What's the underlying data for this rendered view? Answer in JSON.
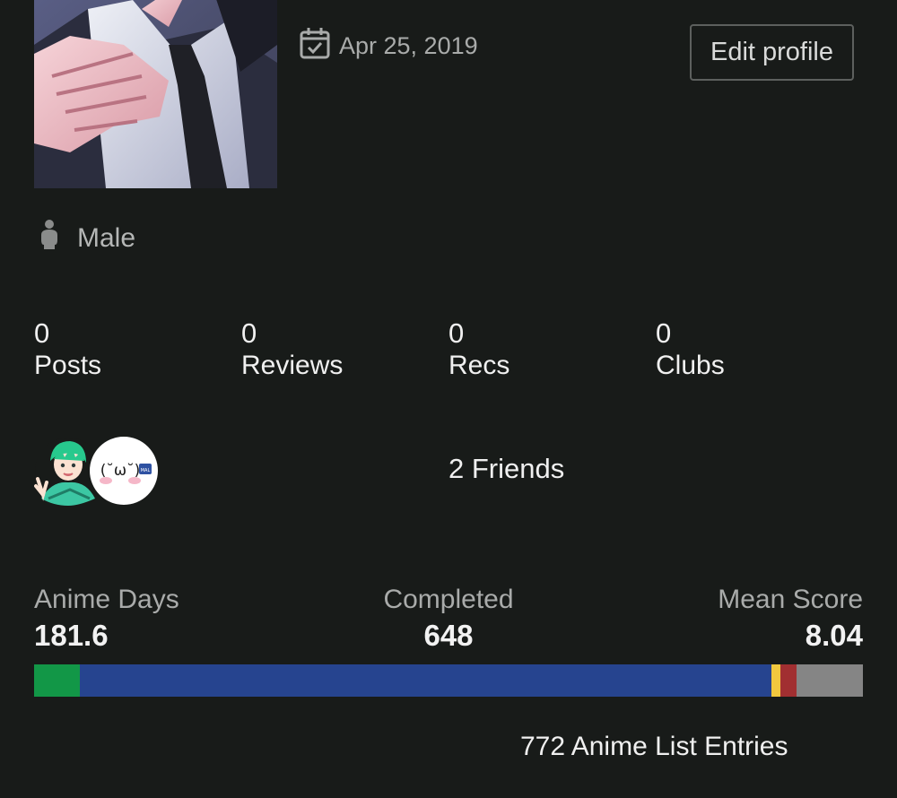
{
  "profile": {
    "joined_date": "Apr 25, 2019",
    "edit_label": "Edit profile",
    "gender": "Male"
  },
  "stats": [
    {
      "count": "0",
      "label": "Posts"
    },
    {
      "count": "0",
      "label": "Reviews"
    },
    {
      "count": "0",
      "label": "Recs"
    },
    {
      "count": "0",
      "label": "Clubs"
    }
  ],
  "friends": {
    "label": "2 Friends",
    "emoticon": "(˘ω˘)",
    "badge": "MAL"
  },
  "summary": {
    "anime_days_label": "Anime Days",
    "anime_days_value": "181.6",
    "completed_label": "Completed",
    "completed_value": "648",
    "mean_score_label": "Mean Score",
    "mean_score_value": "8.04"
  },
  "status_breakdown": [
    {
      "status": "watching",
      "color": "#129747",
      "fraction": 0.055
    },
    {
      "status": "completed",
      "color": "#26448f",
      "fraction": 0.835
    },
    {
      "status": "on-hold",
      "color": "#f1c83e",
      "fraction": 0.01
    },
    {
      "status": "dropped",
      "color": "#a12f31",
      "fraction": 0.02
    },
    {
      "status": "plan-to-watch",
      "color": "#858585",
      "fraction": 0.08
    }
  ],
  "entries_label": "772 Anime List Entries"
}
